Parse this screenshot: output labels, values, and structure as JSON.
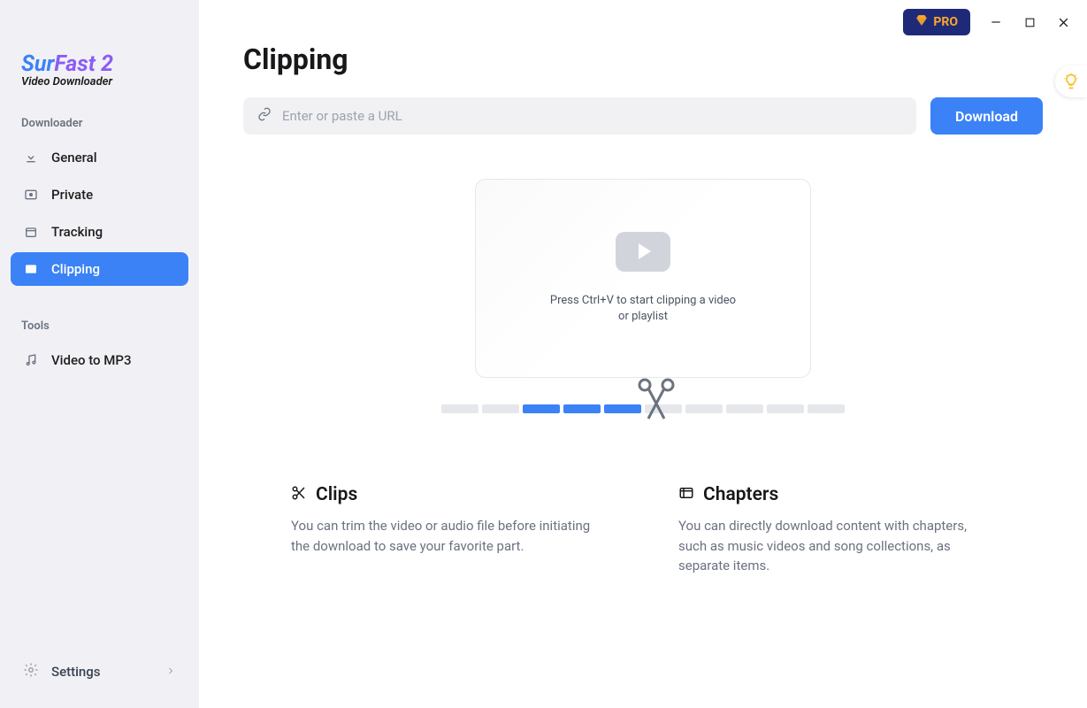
{
  "logo": {
    "part1": "Sur",
    "part2": "Fast",
    "part3": " 2",
    "subtitle": "Video Downloader"
  },
  "sidebar": {
    "sections": {
      "downloader_label": "Downloader",
      "tools_label": "Tools"
    },
    "items": {
      "general": "General",
      "private": "Private",
      "tracking": "Tracking",
      "clipping": "Clipping",
      "video_to_mp3": "Video to MP3"
    },
    "settings": "Settings"
  },
  "titlebar": {
    "pro": "PRO"
  },
  "page": {
    "title": "Clipping",
    "url_placeholder": "Enter or paste a URL",
    "download_btn": "Download",
    "hint_line1": "Press Ctrl+V to start clipping a video",
    "hint_line2": "or playlist"
  },
  "features": {
    "clips": {
      "title": "Clips",
      "desc": "You can trim the video or audio file before initiating the download to save your favorite part."
    },
    "chapters": {
      "title": "Chapters",
      "desc": "You can directly download content with chapters, such as music videos and song collections, as separate items."
    }
  }
}
